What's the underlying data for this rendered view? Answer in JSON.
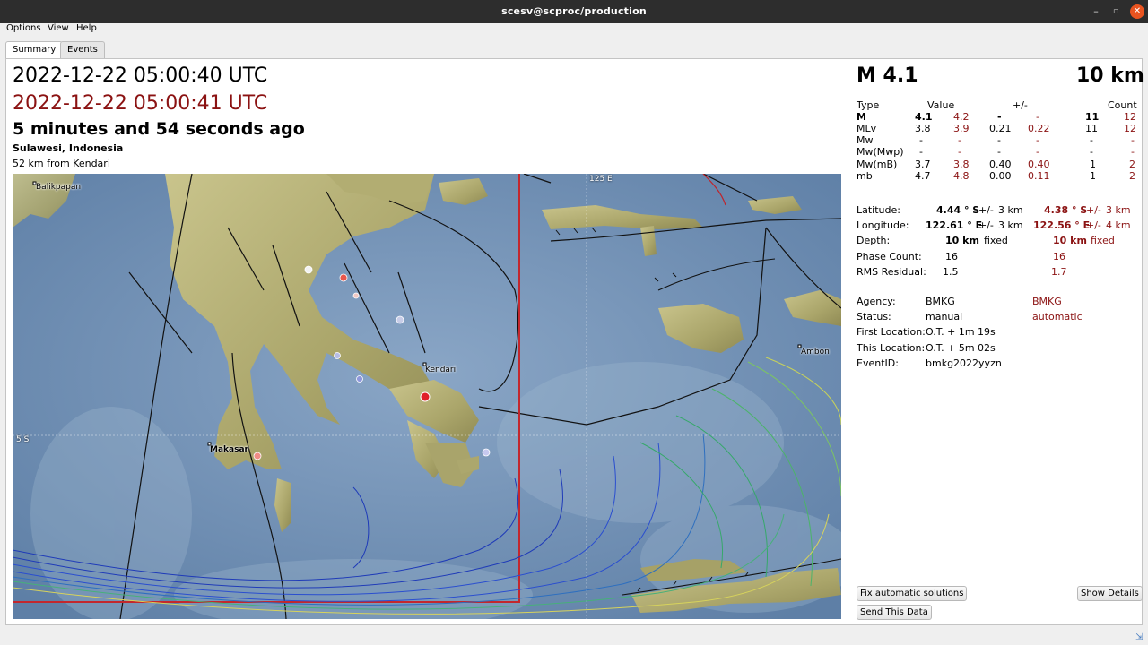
{
  "window": {
    "title": "scesv@scproc/production",
    "min": "–",
    "max": "▫",
    "close": "✕"
  },
  "menu": [
    "Options",
    "View",
    "Help"
  ],
  "tabs": [
    "Summary",
    "Events"
  ],
  "summary": {
    "origin_time": "2022-12-22 05:00:40 UTC",
    "auto_time": "2022-12-22 05:00:41 UTC",
    "ago": "5 minutes and 54 seconds ago",
    "region": "Sulawesi, Indonesia",
    "nearest": "52 km from Kendari"
  },
  "map": {
    "labels": [
      "Balikpapan",
      "Kendari",
      "Makasar",
      "Ambon",
      "125 E",
      "5 S"
    ]
  },
  "header": {
    "magnitude": "M 4.1",
    "depth": "10 km"
  },
  "mag_table": {
    "headers": [
      "Type",
      "Value",
      "+/-",
      "Count"
    ],
    "rows": [
      {
        "type": "M",
        "v1": "4.1",
        "v2": "4.2",
        "e1": "-",
        "e2": "-",
        "c1": "11",
        "c2": "12"
      },
      {
        "type": "MLv",
        "v1": "3.8",
        "v2": "3.9",
        "e1": "0.21",
        "e2": "0.22",
        "c1": "11",
        "c2": "12"
      },
      {
        "type": "Mw",
        "v1": "-",
        "v2": "-",
        "e1": "-",
        "e2": "-",
        "c1": "-",
        "c2": "-"
      },
      {
        "type": "Mw(Mwp)",
        "v1": "-",
        "v2": "-",
        "e1": "-",
        "e2": "-",
        "c1": "-",
        "c2": "-"
      },
      {
        "type": "Mw(mB)",
        "v1": "3.7",
        "v2": "3.8",
        "e1": "0.40",
        "e2": "0.40",
        "c1": "1",
        "c2": "2"
      },
      {
        "type": "mb",
        "v1": "4.7",
        "v2": "4.8",
        "e1": "0.00",
        "e2": "0.11",
        "c1": "1",
        "c2": "2"
      }
    ]
  },
  "location": {
    "lat_label": "Latitude:",
    "lat_v1": "4.44 ° S",
    "lat_pm": "+/-",
    "lat_e1": "3 km",
    "lat_v2": "4.38 ° S",
    "lat_e2": "3 km",
    "lon_label": "Longitude:",
    "lon_v1": "122.61 ° E",
    "lon_pm": "+/-",
    "lon_e1": "3 km",
    "lon_v2": "122.56 ° E",
    "lon_e2": "4 km",
    "dep_label": "Depth:",
    "dep_v1": "10 km",
    "dep_f1": "fixed",
    "dep_v2": "10 km",
    "dep_f2": "fixed",
    "phase_label": "Phase Count:",
    "phase_v1": "16",
    "phase_v2": "16",
    "rms_label": "RMS Residual:",
    "rms_v1": "1.5",
    "rms_v2": "1.7"
  },
  "info": {
    "agency_label": "Agency:",
    "agency_v1": "BMKG",
    "agency_v2": "BMKG",
    "status_label": "Status:",
    "status_v1": "manual",
    "status_v2": "automatic",
    "first_label": "First Location:",
    "first_v": "O.T. + 1m 19s",
    "this_label": "This Location:",
    "this_v": "O.T. + 5m 02s",
    "event_label": "EventID:",
    "event_v": "bmkg2022yyzn"
  },
  "buttons": {
    "fix": "Fix automatic solutions",
    "details": "Show Details",
    "send": "Send This Data"
  },
  "colors": {
    "accent_red": "#8b1212",
    "titlebar": "#2d2d2d",
    "close_btn": "#e95420"
  }
}
